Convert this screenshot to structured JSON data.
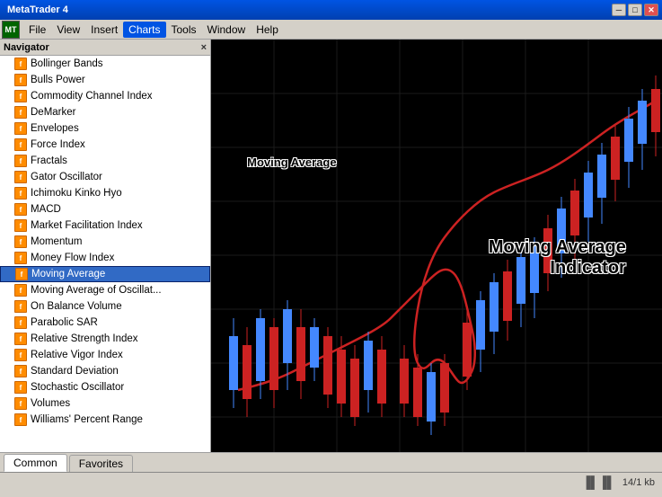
{
  "window": {
    "title": "MetaTrader 4",
    "controls": {
      "minimize": "─",
      "maximize": "□",
      "close": "✕"
    }
  },
  "menubar": {
    "logo": "MT",
    "items": [
      "File",
      "View",
      "Insert",
      "Charts",
      "Tools",
      "Window",
      "Help"
    ],
    "active": "Charts"
  },
  "navigator": {
    "title": "Navigator",
    "close_label": "×",
    "items": [
      {
        "label": "Bollinger Bands"
      },
      {
        "label": "Bulls Power"
      },
      {
        "label": "Commodity Channel Index"
      },
      {
        "label": "DeMarker"
      },
      {
        "label": "Envelopes"
      },
      {
        "label": "Force Index"
      },
      {
        "label": "Fractals"
      },
      {
        "label": "Gator Oscillator"
      },
      {
        "label": "Ichimoku Kinko Hyo"
      },
      {
        "label": "MACD"
      },
      {
        "label": "Market Facilitation Index"
      },
      {
        "label": "Momentum"
      },
      {
        "label": "Money Flow Index"
      },
      {
        "label": "Moving Average",
        "selected": true
      },
      {
        "label": "Moving Average of Oscillat..."
      },
      {
        "label": "On Balance Volume"
      },
      {
        "label": "Parabolic SAR"
      },
      {
        "label": "Relative Strength Index"
      },
      {
        "label": "Relative Vigor Index"
      },
      {
        "label": "Standard Deviation"
      },
      {
        "label": "Stochastic Oscillator"
      },
      {
        "label": "Volumes"
      },
      {
        "label": "Williams' Percent Range"
      }
    ]
  },
  "chart": {
    "label_ma": "Moving Average",
    "label_indicator_line1": "Moving Average",
    "label_indicator_line2": "Indicator"
  },
  "tabs": [
    {
      "label": "Common",
      "active": true
    },
    {
      "label": "Favorites",
      "active": false
    }
  ],
  "statusbar": {
    "icon": "▐▌▐▌",
    "info": "14/1 kb"
  }
}
